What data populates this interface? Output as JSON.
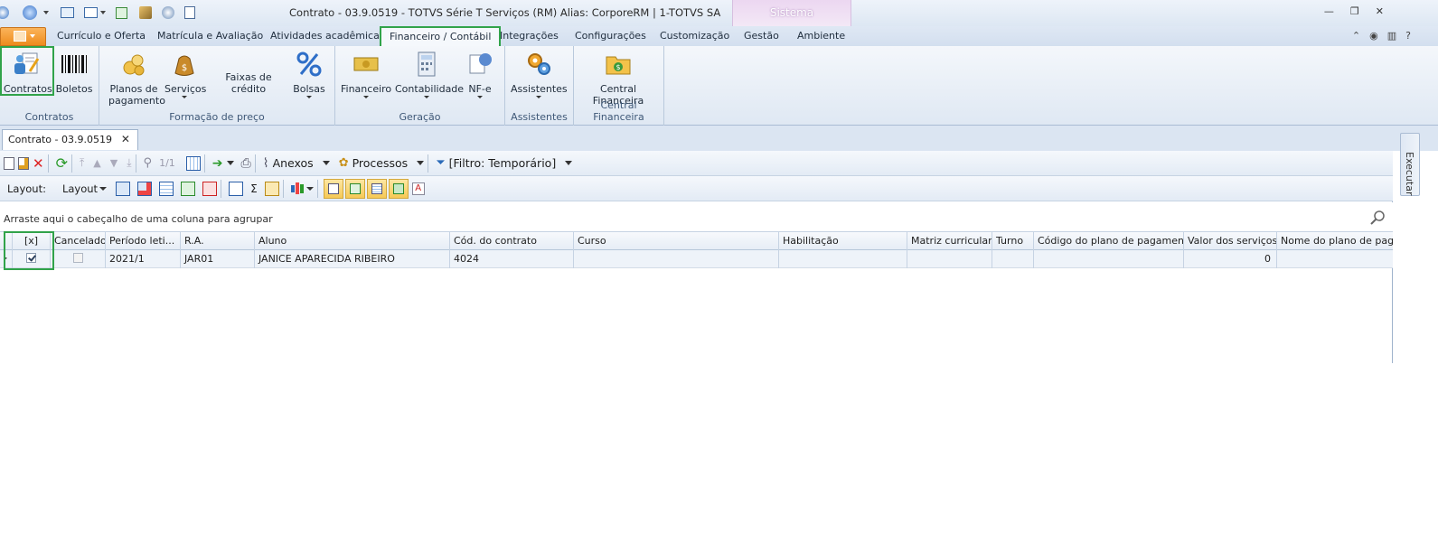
{
  "window": {
    "title": "Contrato - 03.9.0519 - TOTVS Série T Serviços (RM) Alias: CorporeRM | 1-TOTVS SA",
    "sistema_tab": "Sistema"
  },
  "ribbon_tabs": [
    {
      "label": "Currículo e Oferta"
    },
    {
      "label": "Matrícula e Avaliação"
    },
    {
      "label": "Atividades acadêmicas"
    },
    {
      "label": "Financeiro / Contábil",
      "active": true
    },
    {
      "label": "Integrações"
    },
    {
      "label": "Configurações"
    },
    {
      "label": "Customização"
    },
    {
      "label": "Gestão"
    },
    {
      "label": "Ambiente"
    }
  ],
  "ribbon": {
    "contratos": {
      "label": "Contratos",
      "group": "Contratos"
    },
    "boletos": {
      "label": "Boletos"
    },
    "planos_line1": "Planos de",
    "planos_line2": "pagamento",
    "servicos": "Serviços",
    "faixas": "Faixas de crédito",
    "bolsas": "Bolsas",
    "formacao_group": "Formação de preço",
    "financeiro": "Financeiro",
    "contabilidade": "Contabilidade",
    "nfe": "NF-e",
    "geracao_group": "Geração",
    "assistentes": "Assistentes",
    "assistentes_group": "Assistentes",
    "central_line1": "Central",
    "central_line2": "Financeira",
    "central_group": "Central Financeira"
  },
  "doc_tab": {
    "label": "Contrato - 03.9.0519",
    "close": "✕"
  },
  "toolbar": {
    "record_nav": "1/1",
    "anexos": "Anexos",
    "processos": "Processos",
    "filtro": "[Filtro: Temporário]",
    "layout_label": "Layout:",
    "layout_menu": "Layout"
  },
  "groupby_hint": "Arraste aqui o cabeçalho de uma coluna para agrupar",
  "grid": {
    "columns": [
      "[x]",
      "Cancelado",
      "Período leti...",
      "R.A.",
      "Aluno",
      "Cód. do contrato",
      "Curso",
      "Habilitação",
      "Matriz curricular",
      "Turno",
      "Código do plano de pagamento",
      "Valor dos serviços",
      "Nome do plano de pagame"
    ],
    "rows": [
      {
        "selected": true,
        "cancelado": false,
        "periodo": "2021/1",
        "ra": "JAR01",
        "aluno": "JANICE APARECIDA RIBEIRO",
        "cod_contrato": "4024",
        "curso": "",
        "habilitacao": "",
        "matriz": "",
        "turno": "",
        "cod_plano": "",
        "valor": "0",
        "nome_plano": ""
      }
    ]
  },
  "side_panel": {
    "label": "Executar"
  },
  "colors": {
    "highlight": "#31a34a",
    "app_button": "#ee8b1d",
    "ribbon_bg": "#dfe8f3"
  }
}
